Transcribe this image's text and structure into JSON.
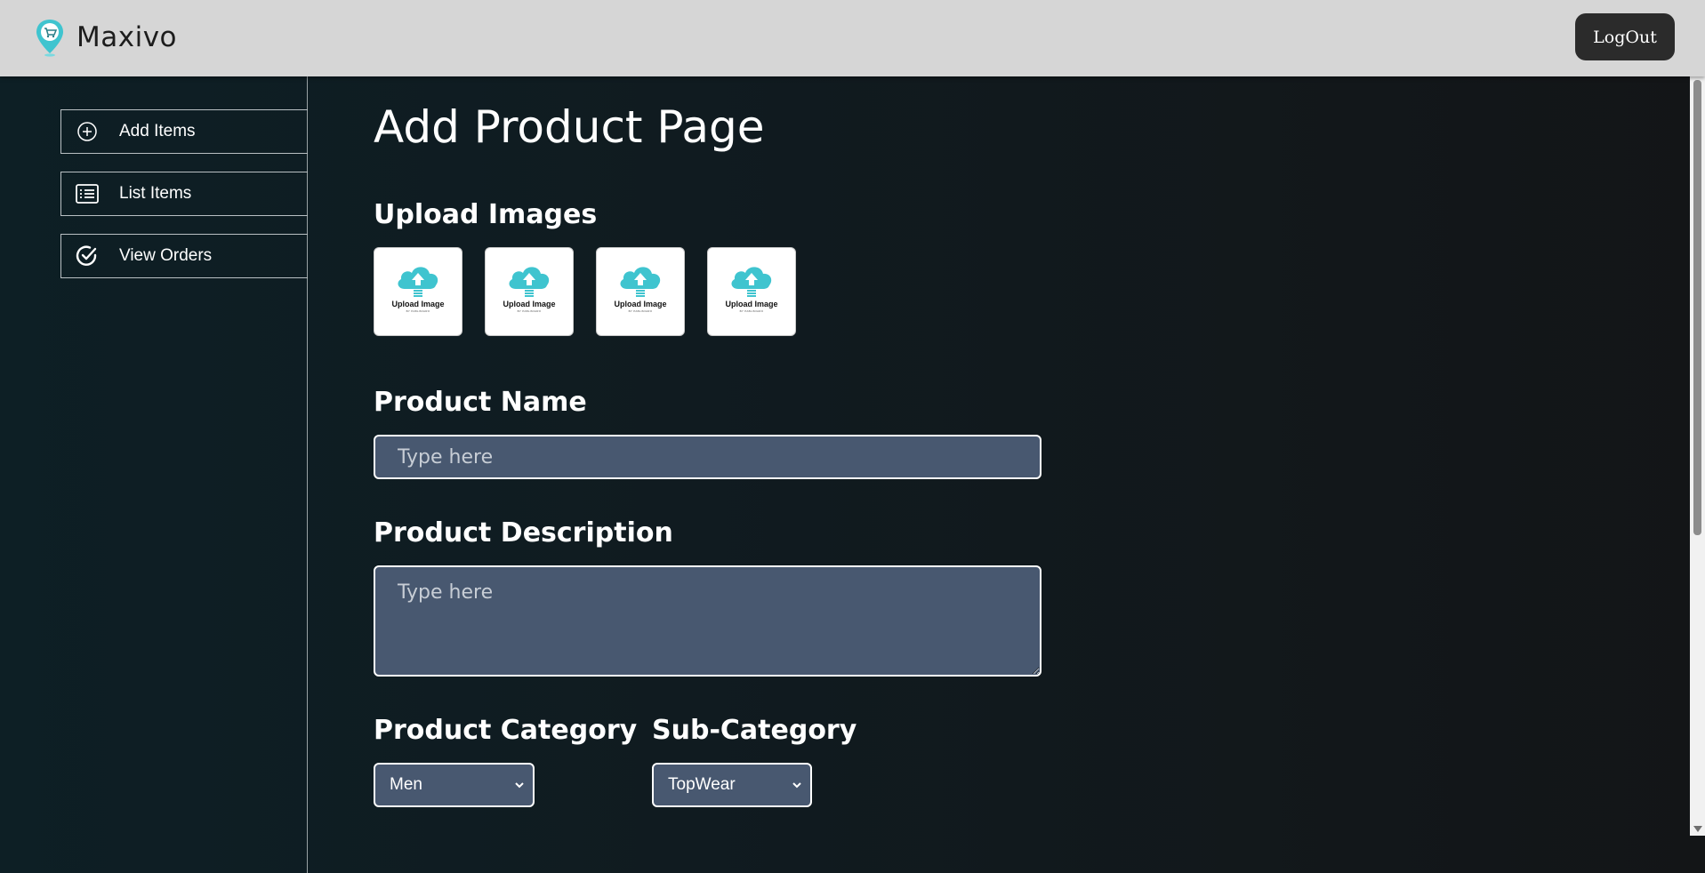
{
  "app": {
    "name": "Maxivo",
    "logout_label": "LogOut"
  },
  "sidebar": {
    "items": [
      {
        "label": "Add Items",
        "icon": "plus-circle-icon"
      },
      {
        "label": "List Items",
        "icon": "list-icon"
      },
      {
        "label": "View Orders",
        "icon": "check-circle-icon"
      }
    ]
  },
  "main": {
    "title": "Add Product Page",
    "upload": {
      "label": "Upload Images",
      "tile_text": "Upload Image",
      "tile_subtext": "BY PABLIMIARO",
      "tiles": 4
    },
    "product_name": {
      "label": "Product Name",
      "placeholder": "Type here",
      "value": ""
    },
    "product_description": {
      "label": "Product Description",
      "placeholder": "Type here",
      "value": ""
    },
    "category": {
      "label": "Product Category",
      "selected": "Men"
    },
    "sub_category": {
      "label": "Sub-Category",
      "selected": "TopWear"
    }
  },
  "colors": {
    "topbar": "#d6d6d6",
    "logout_bg": "#2b2b2b",
    "input_bg": "#485870",
    "accent_teal": "#3fc4cf"
  }
}
